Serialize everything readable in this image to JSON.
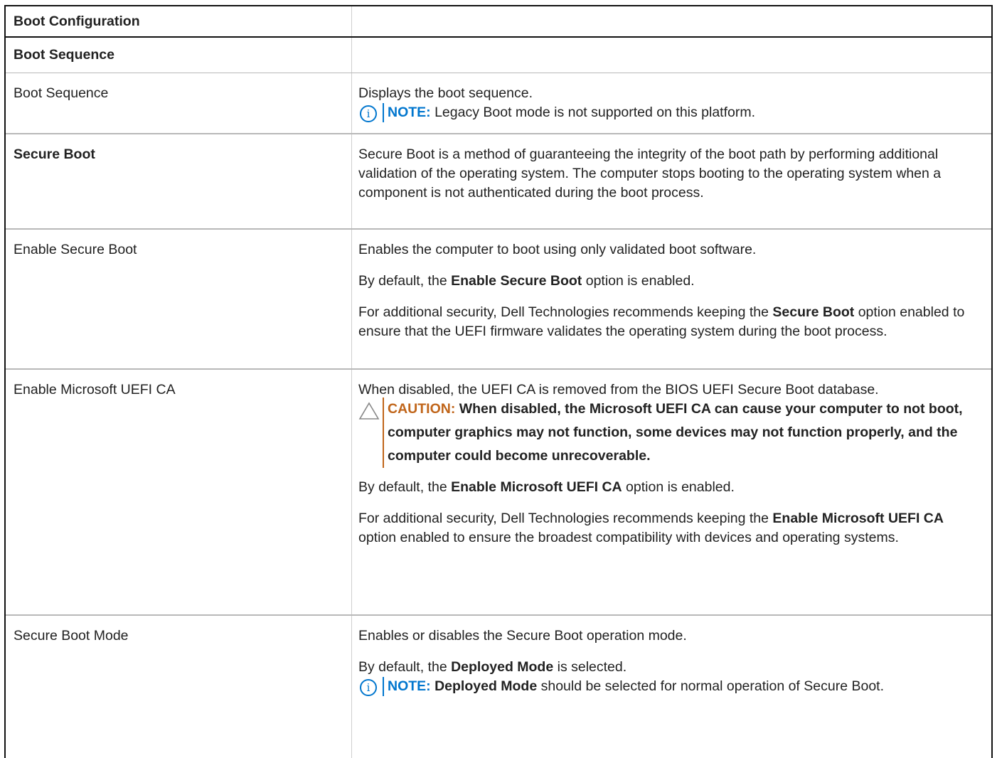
{
  "table": {
    "title": "Boot Configuration",
    "section": "Boot Sequence",
    "rows": [
      {
        "option": "Boot Sequence",
        "desc1": "Displays the boot sequence.",
        "note_label": "NOTE:",
        "note_text": " Legacy Boot mode is not supported on this platform."
      },
      {
        "option": "Secure Boot",
        "desc1": "Secure Boot is a method of guaranteeing the integrity of the boot path by performing additional validation of the operating system. The computer stops booting to the operating system when a component is not authenticated during the boot process."
      },
      {
        "option": "Enable Secure Boot",
        "desc1": "Enables the computer to boot using only validated boot software.",
        "desc2_pre": "By default, the ",
        "desc2_bold": "Enable Secure Boot",
        "desc2_post": " option is enabled.",
        "desc3_pre": "For additional security, Dell Technologies recommends keeping the ",
        "desc3_bold": "Secure Boot",
        "desc3_post": " option enabled to ensure that the UEFI firmware validates the operating system during the boot process."
      },
      {
        "option": "Enable Microsoft UEFI CA",
        "desc1": "When disabled, the UEFI CA is removed from the BIOS UEFI Secure Boot database.",
        "caution_label": "CAUTION:",
        "caution_text": " When disabled, the Microsoft UEFI CA can cause your computer to not boot, computer graphics may not function, some devices may not function properly, and the computer could become unrecoverable.",
        "desc2_pre": "By default, the ",
        "desc2_bold": "Enable Microsoft UEFI CA",
        "desc2_post": " option is enabled.",
        "desc3_pre": "For additional security, Dell Technologies recommends keeping the ",
        "desc3_bold": "Enable Microsoft UEFI CA",
        "desc3_post": " option enabled to ensure the broadest compatibility with devices and operating systems."
      },
      {
        "option": "Secure Boot Mode",
        "desc1": "Enables or disables the Secure Boot operation mode.",
        "desc2_pre": "By default, the ",
        "desc2_bold": "Deployed Mode",
        "desc2_post": " is selected.",
        "note_label": "NOTE:",
        "note_bold": "Deployed Mode",
        "note_text": " should be selected for normal operation of Secure Boot."
      }
    ]
  },
  "icons": {
    "note": "info-icon",
    "caution": "warning-triangle-icon"
  },
  "colors": {
    "note": "#0076ce",
    "caution": "#c0651a",
    "border": "#111111"
  }
}
